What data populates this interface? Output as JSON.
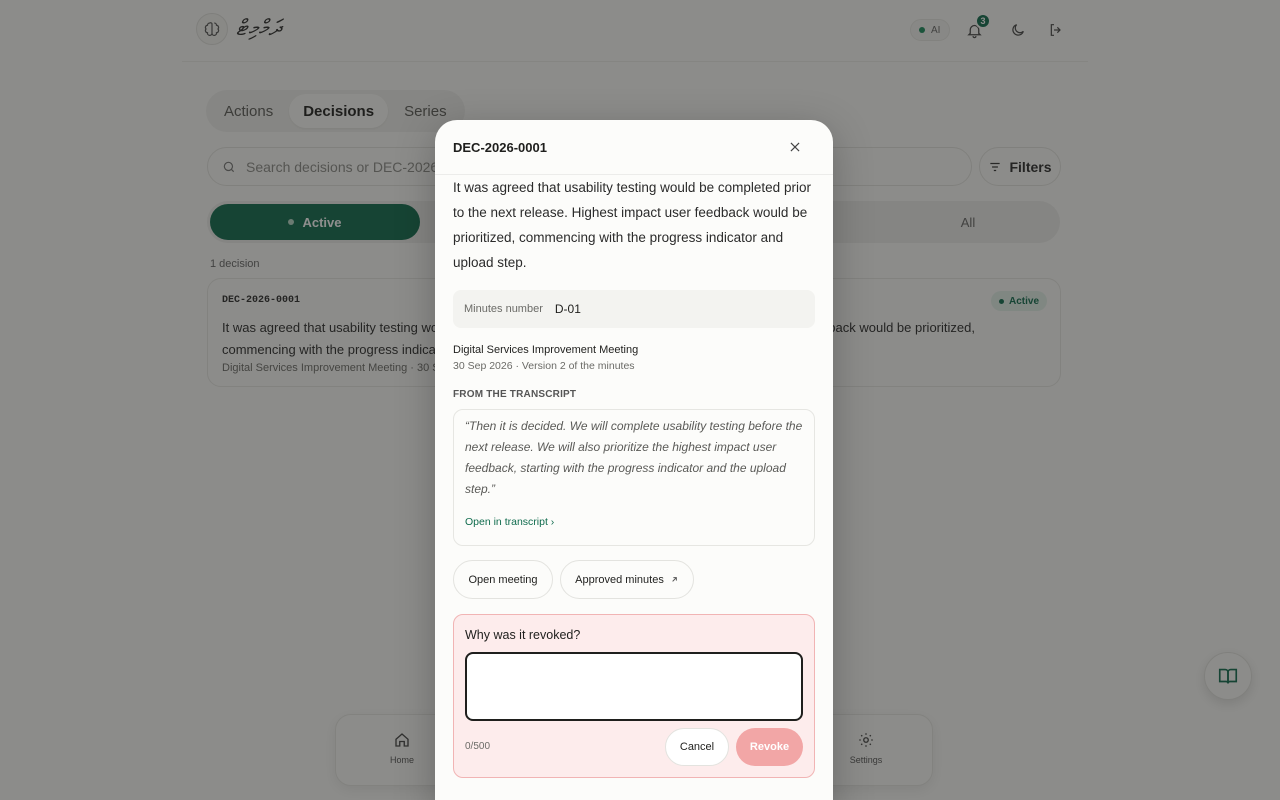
{
  "header": {
    "logo_text": "ދަމްމިޓް",
    "ai_label": "AI",
    "notification_count": "3"
  },
  "tabs": [
    {
      "label": "Actions"
    },
    {
      "label": "Decisions"
    },
    {
      "label": "Series"
    }
  ],
  "search": {
    "placeholder": "Search decisions or DEC-2026-0001"
  },
  "filters_label": "Filters",
  "segment": {
    "active_label": "Active",
    "all_label": "All"
  },
  "count_label": "1 decision",
  "card": {
    "id": "DEC-2026-0001",
    "status": "Active",
    "text": "It was agreed that usability testing would be completed prior to the next release. Highest impact user feedback would be prioritized, commencing with the progress indicator and upload step.",
    "meta": "Digital Services Improvement Meeting · 30 Sep 2026"
  },
  "bottom_nav": [
    {
      "label": "Home"
    },
    {
      "label": "Settings"
    }
  ],
  "modal": {
    "title": "DEC-2026-0001",
    "text": "It was agreed that usability testing would be completed prior to the next release. Highest impact user feedback would be prioritized, commencing with the progress indicator and upload step.",
    "minutes_label": "Minutes number",
    "minutes_value": "D-01",
    "meeting_title": "Digital Services Improvement Meeting",
    "meeting_date": "30 Sep 2026 · Version 2 of the minutes",
    "section_title": "FROM THE TRANSCRIPT",
    "quote": "“Then it is decided. We will complete usability testing before the next release. We will also prioritize the highest impact user feedback, starting with the progress indicator and the upload step.”",
    "open_transcript": "Open in transcript ›",
    "open_meeting": "Open meeting",
    "approved_minutes": "Approved minutes",
    "revoke_question": "Why was it revoked?",
    "revoke_count": "0/500",
    "cancel_label": "Cancel",
    "revoke_label": "Revoke"
  },
  "colors": {
    "accent": "#0f6b4d",
    "danger_bg": "#fdecec",
    "danger_btn": "#f2a6a6"
  }
}
